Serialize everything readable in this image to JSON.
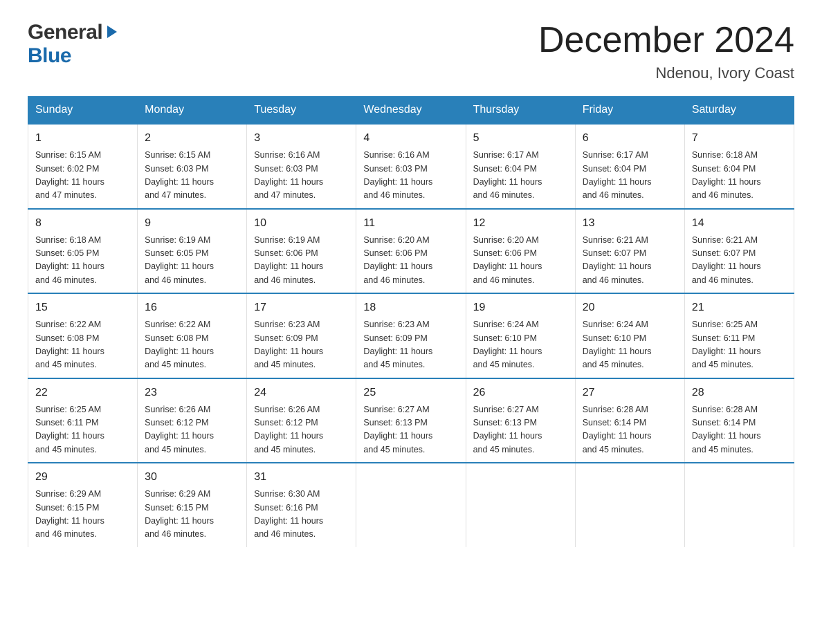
{
  "header": {
    "logo_general": "General",
    "logo_blue": "Blue",
    "month_title": "December 2024",
    "location": "Ndenou, Ivory Coast"
  },
  "days_of_week": [
    "Sunday",
    "Monday",
    "Tuesday",
    "Wednesday",
    "Thursday",
    "Friday",
    "Saturday"
  ],
  "weeks": [
    [
      {
        "num": "1",
        "sunrise": "6:15 AM",
        "sunset": "6:02 PM",
        "daylight": "11 hours and 47 minutes."
      },
      {
        "num": "2",
        "sunrise": "6:15 AM",
        "sunset": "6:03 PM",
        "daylight": "11 hours and 47 minutes."
      },
      {
        "num": "3",
        "sunrise": "6:16 AM",
        "sunset": "6:03 PM",
        "daylight": "11 hours and 47 minutes."
      },
      {
        "num": "4",
        "sunrise": "6:16 AM",
        "sunset": "6:03 PM",
        "daylight": "11 hours and 46 minutes."
      },
      {
        "num": "5",
        "sunrise": "6:17 AM",
        "sunset": "6:04 PM",
        "daylight": "11 hours and 46 minutes."
      },
      {
        "num": "6",
        "sunrise": "6:17 AM",
        "sunset": "6:04 PM",
        "daylight": "11 hours and 46 minutes."
      },
      {
        "num": "7",
        "sunrise": "6:18 AM",
        "sunset": "6:04 PM",
        "daylight": "11 hours and 46 minutes."
      }
    ],
    [
      {
        "num": "8",
        "sunrise": "6:18 AM",
        "sunset": "6:05 PM",
        "daylight": "11 hours and 46 minutes."
      },
      {
        "num": "9",
        "sunrise": "6:19 AM",
        "sunset": "6:05 PM",
        "daylight": "11 hours and 46 minutes."
      },
      {
        "num": "10",
        "sunrise": "6:19 AM",
        "sunset": "6:06 PM",
        "daylight": "11 hours and 46 minutes."
      },
      {
        "num": "11",
        "sunrise": "6:20 AM",
        "sunset": "6:06 PM",
        "daylight": "11 hours and 46 minutes."
      },
      {
        "num": "12",
        "sunrise": "6:20 AM",
        "sunset": "6:06 PM",
        "daylight": "11 hours and 46 minutes."
      },
      {
        "num": "13",
        "sunrise": "6:21 AM",
        "sunset": "6:07 PM",
        "daylight": "11 hours and 46 minutes."
      },
      {
        "num": "14",
        "sunrise": "6:21 AM",
        "sunset": "6:07 PM",
        "daylight": "11 hours and 46 minutes."
      }
    ],
    [
      {
        "num": "15",
        "sunrise": "6:22 AM",
        "sunset": "6:08 PM",
        "daylight": "11 hours and 45 minutes."
      },
      {
        "num": "16",
        "sunrise": "6:22 AM",
        "sunset": "6:08 PM",
        "daylight": "11 hours and 45 minutes."
      },
      {
        "num": "17",
        "sunrise": "6:23 AM",
        "sunset": "6:09 PM",
        "daylight": "11 hours and 45 minutes."
      },
      {
        "num": "18",
        "sunrise": "6:23 AM",
        "sunset": "6:09 PM",
        "daylight": "11 hours and 45 minutes."
      },
      {
        "num": "19",
        "sunrise": "6:24 AM",
        "sunset": "6:10 PM",
        "daylight": "11 hours and 45 minutes."
      },
      {
        "num": "20",
        "sunrise": "6:24 AM",
        "sunset": "6:10 PM",
        "daylight": "11 hours and 45 minutes."
      },
      {
        "num": "21",
        "sunrise": "6:25 AM",
        "sunset": "6:11 PM",
        "daylight": "11 hours and 45 minutes."
      }
    ],
    [
      {
        "num": "22",
        "sunrise": "6:25 AM",
        "sunset": "6:11 PM",
        "daylight": "11 hours and 45 minutes."
      },
      {
        "num": "23",
        "sunrise": "6:26 AM",
        "sunset": "6:12 PM",
        "daylight": "11 hours and 45 minutes."
      },
      {
        "num": "24",
        "sunrise": "6:26 AM",
        "sunset": "6:12 PM",
        "daylight": "11 hours and 45 minutes."
      },
      {
        "num": "25",
        "sunrise": "6:27 AM",
        "sunset": "6:13 PM",
        "daylight": "11 hours and 45 minutes."
      },
      {
        "num": "26",
        "sunrise": "6:27 AM",
        "sunset": "6:13 PM",
        "daylight": "11 hours and 45 minutes."
      },
      {
        "num": "27",
        "sunrise": "6:28 AM",
        "sunset": "6:14 PM",
        "daylight": "11 hours and 45 minutes."
      },
      {
        "num": "28",
        "sunrise": "6:28 AM",
        "sunset": "6:14 PM",
        "daylight": "11 hours and 45 minutes."
      }
    ],
    [
      {
        "num": "29",
        "sunrise": "6:29 AM",
        "sunset": "6:15 PM",
        "daylight": "11 hours and 46 minutes."
      },
      {
        "num": "30",
        "sunrise": "6:29 AM",
        "sunset": "6:15 PM",
        "daylight": "11 hours and 46 minutes."
      },
      {
        "num": "31",
        "sunrise": "6:30 AM",
        "sunset": "6:16 PM",
        "daylight": "11 hours and 46 minutes."
      },
      null,
      null,
      null,
      null
    ]
  ],
  "labels": {
    "sunrise": "Sunrise:",
    "sunset": "Sunset:",
    "daylight": "Daylight:"
  }
}
